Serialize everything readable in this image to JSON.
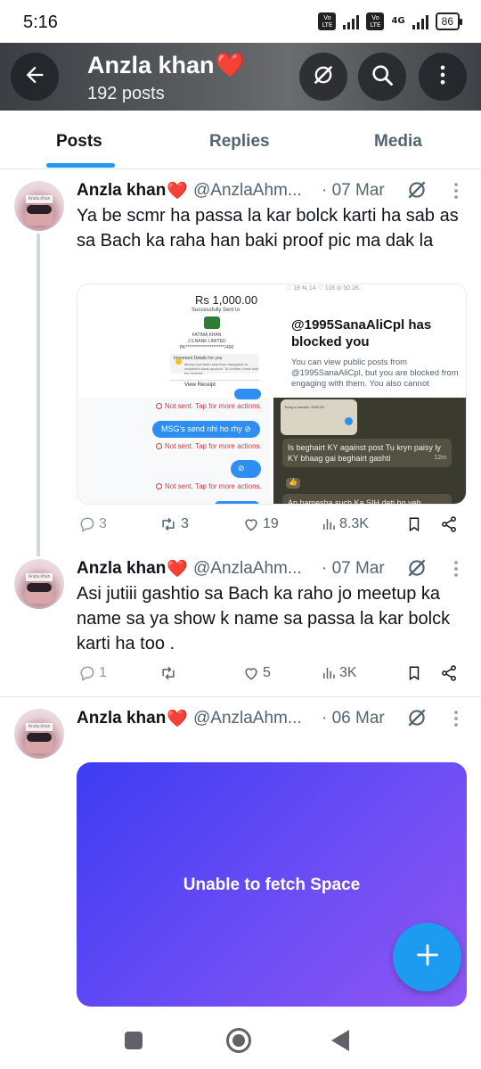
{
  "status_bar": {
    "time": "5:16",
    "volte_label": "Vo LTE",
    "network_type": "4G",
    "battery_level": "86"
  },
  "header": {
    "title": "Anzla khan",
    "title_emoji": "❤️",
    "post_count": "192 posts",
    "icons": [
      "back-arrow-icon",
      "grok-icon",
      "search-icon",
      "more-vertical-icon"
    ]
  },
  "tabs": [
    {
      "label": "Posts",
      "active": true
    },
    {
      "label": "Replies",
      "active": false
    },
    {
      "label": "Media",
      "active": false
    }
  ],
  "posts": [
    {
      "name": "Anzla khan",
      "emoji": "❤️",
      "handle": "@AnzlaAhm...",
      "date": "· 07 Mar",
      "text": "Ya be scmr ha passa la kar bolck karti ha sab as sa Bach ka raha han baki proof pic ma dak la",
      "media": {
        "receipt": {
          "amount": "Rs 1,000.00",
          "status": "Successfully Sent to",
          "recipient": "FATIMA KHAN",
          "bank": "J.S BANK LIMITED",
          "account": "PK**********************7400",
          "notice_title": "Important Details for you",
          "notice_text": "Money has been sent from easypaisa to recipient's bank account. To confirm check with the receiver",
          "view_label": "View Receipt"
        },
        "blocked": {
          "stats": "♡ 18   ⇆ 14   ♡ 118   ılı 50.2K",
          "title": "@1995SanaAliCpl has blocked you",
          "body": "You can view public posts from @1995SanaAliCpl, but you are blocked from engaging with them. You also cannot"
        },
        "chat": {
          "error1": "Not sent. Tap for more actions.",
          "bubble1": "MSG's send nhi ho rhy",
          "error2": "Not sent. Tap for more actions.",
          "bubble2": "",
          "error3": "Not sent. Tap for more actions."
        },
        "whatsapp": {
          "top_text": "Today's transfer: 5000 Rs",
          "msg1": "Is beghairt KY against post Tu kryn paisy ly KY bhaag gai beghairt gashti",
          "msg1_time": "12m",
          "msg2": "Ap hamesha such Ka SIH deti ho yeh"
        }
      },
      "stats": {
        "replies": "3",
        "reposts": "3",
        "likes": "19",
        "views": "8.3K"
      }
    },
    {
      "name": "Anzla khan",
      "emoji": "❤️",
      "handle": "@AnzlaAhm...",
      "date": "· 07 Mar",
      "text": "Asi jutiii gashtio sa Bach ka raho jo meetup ka name sa ya show k name sa passa la kar bolck karti ha too .",
      "stats": {
        "replies": "1",
        "reposts": "",
        "likes": "5",
        "views": "3K"
      }
    },
    {
      "name": "Anzla khan",
      "emoji": "❤️",
      "handle": "@AnzlaAhm...",
      "date": "· 06 Mar",
      "space_message": "Unable to fetch Space"
    }
  ],
  "colors": {
    "accent": "#1d9bf0",
    "text": "#0f1419",
    "muted": "#536471",
    "heart": "#e0263a",
    "space_gradient_start": "#3e3cf2",
    "space_gradient_end": "#8f56f2"
  }
}
